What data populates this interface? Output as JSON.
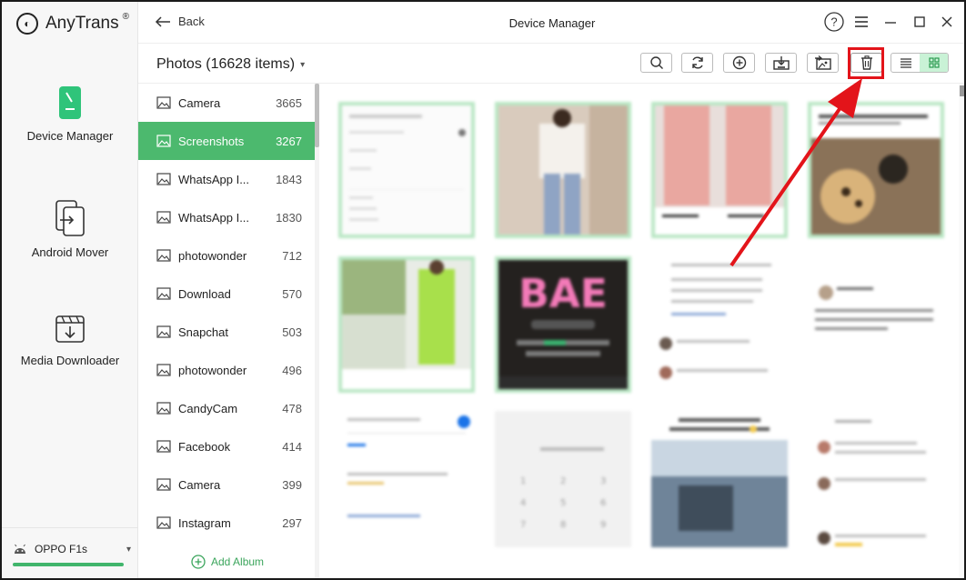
{
  "app": {
    "name": "AnyTrans",
    "reg": "®"
  },
  "nav": {
    "device_manager": "Device Manager",
    "android_mover": "Android Mover",
    "media_downloader": "Media Downloader"
  },
  "device": {
    "name": "OPPO F1s",
    "storage_fraction": 0.97
  },
  "titlebar": {
    "back": "Back",
    "title": "Device Manager"
  },
  "toolbar": {
    "album_title": "Photos (16628 items)"
  },
  "albums": [
    {
      "name": "Camera",
      "count": "3665"
    },
    {
      "name": "Screenshots",
      "count": "3267"
    },
    {
      "name": "WhatsApp I...",
      "count": "1843"
    },
    {
      "name": "WhatsApp I...",
      "count": "1830"
    },
    {
      "name": "photowonder",
      "count": "712"
    },
    {
      "name": "Download",
      "count": "570"
    },
    {
      "name": "Snapchat",
      "count": "503"
    },
    {
      "name": "photowonder",
      "count": "496"
    },
    {
      "name": "CandyCam",
      "count": "478"
    },
    {
      "name": "Facebook",
      "count": "414"
    },
    {
      "name": "Camera",
      "count": "399"
    },
    {
      "name": "Instagram",
      "count": "297"
    }
  ],
  "add_album": "Add Album",
  "colors": {
    "accent": "#4cb96e",
    "highlight_red": "#e3141a"
  },
  "icons": {
    "search": "search-icon",
    "refresh": "refresh-icon",
    "add": "plus-circle-icon",
    "export": "export-to-computer-icon",
    "import": "import-icon",
    "delete": "trash-icon",
    "list_view": "list-view-icon",
    "grid_view": "grid-view-icon"
  }
}
